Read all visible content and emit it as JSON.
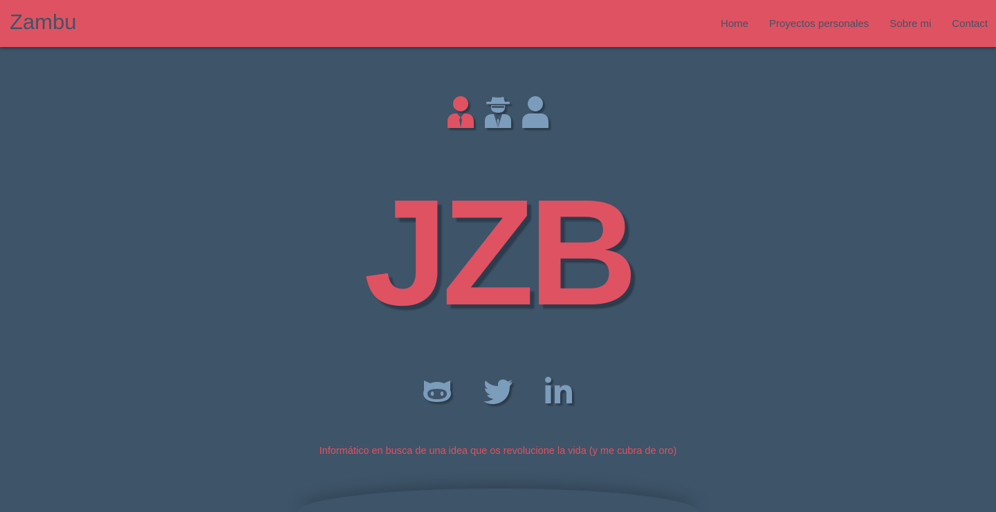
{
  "navbar": {
    "brand": "Zambu",
    "links": [
      {
        "label": "Home"
      },
      {
        "label": "Proyectos personales"
      },
      {
        "label": "Sobre mi"
      },
      {
        "label": "Contact"
      }
    ]
  },
  "hero": {
    "avatars": [
      {
        "icon": "user-tie-icon",
        "color": "#df5262"
      },
      {
        "icon": "user-secret-icon",
        "color": "#7c9cbb"
      },
      {
        "icon": "user-icon",
        "color": "#7c9cbb"
      }
    ],
    "monogram": "JZB",
    "social": [
      {
        "icon": "github-icon"
      },
      {
        "icon": "twitter-icon"
      },
      {
        "icon": "linkedin-icon"
      }
    ],
    "tagline": "Informático en busca de una idea que os revolucione la vida (y me cubra de oro)"
  },
  "colors": {
    "accent": "#df5262",
    "background": "#3e5468",
    "icon": "#7c9cbb"
  }
}
